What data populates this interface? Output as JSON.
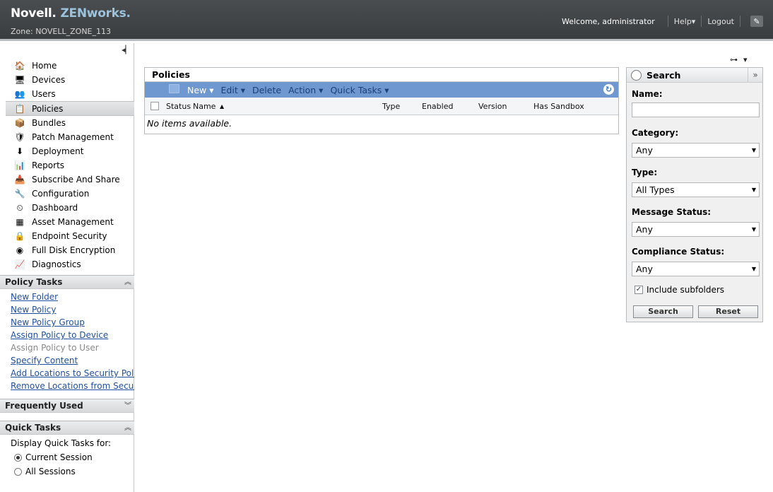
{
  "header": {
    "brand_primary": "Novell.",
    "brand_secondary": "ZENworks.",
    "zone": "Zone: NOVELL_ZONE_113",
    "welcome": "Welcome, administrator",
    "help": "Help▾",
    "logout": "Logout"
  },
  "sidebar": {
    "collapse_glyph": "◂▏",
    "nav": [
      {
        "label": "Home",
        "icon": "🏠"
      },
      {
        "label": "Devices",
        "icon": "🖥"
      },
      {
        "label": "Users",
        "icon": "👥"
      },
      {
        "label": "Policies",
        "icon": "📋"
      },
      {
        "label": "Bundles",
        "icon": "📦"
      },
      {
        "label": "Patch Management",
        "icon": "🛡"
      },
      {
        "label": "Deployment",
        "icon": "⬇"
      },
      {
        "label": "Reports",
        "icon": "📊"
      },
      {
        "label": "Subscribe And Share",
        "icon": "📥"
      },
      {
        "label": "Configuration",
        "icon": "🔧"
      },
      {
        "label": "Dashboard",
        "icon": "⏲"
      },
      {
        "label": "Asset Management",
        "icon": "▦"
      },
      {
        "label": "Endpoint Security",
        "icon": "🔒"
      },
      {
        "label": "Full Disk Encryption",
        "icon": "◉"
      },
      {
        "label": "Diagnostics",
        "icon": "📈"
      }
    ],
    "policy_tasks": {
      "title": "Policy Tasks",
      "items": [
        {
          "label": "New Folder"
        },
        {
          "label": "New Policy"
        },
        {
          "label": "New Policy Group"
        },
        {
          "label": "Assign Policy to Device"
        },
        {
          "label": "Assign Policy to User"
        },
        {
          "label": "Specify Content"
        },
        {
          "label": "Add Locations to Security Poli"
        },
        {
          "label": "Remove Locations from Secur"
        }
      ]
    },
    "frequently_used": {
      "title": "Frequently Used"
    },
    "quick_tasks": {
      "title": "Quick Tasks",
      "display_label": "Display Quick Tasks for:",
      "options": [
        "Current Session",
        "All Sessions"
      ],
      "selected": "Current Session"
    }
  },
  "policies": {
    "title": "Policies",
    "toolbar": {
      "new": "New ▾",
      "edit": "Edit ▾",
      "delete": "Delete",
      "action": "Action ▾",
      "quick_tasks": "Quick Tasks ▾"
    },
    "columns": [
      "Status",
      "Name",
      "Type",
      "Enabled",
      "Version",
      "Has Sandbox"
    ],
    "sort_glyph": "▲",
    "empty_text": "No items available."
  },
  "search": {
    "title": "Search",
    "name_label": "Name:",
    "name_value": "",
    "category_label": "Category:",
    "category_value": "Any",
    "type_label": "Type:",
    "type_value": "All Types",
    "message_status_label": "Message Status:",
    "message_status_value": "Any",
    "compliance_status_label": "Compliance Status:",
    "compliance_status_value": "Any",
    "include_subfolders_label": "Include subfolders",
    "include_subfolders_checked": true,
    "search_button": "Search",
    "reset_button": "Reset"
  },
  "colors": {
    "header_bg": "#3f4245",
    "toolbar_bg": "#6e98cf",
    "link": "#1f4f9e"
  }
}
